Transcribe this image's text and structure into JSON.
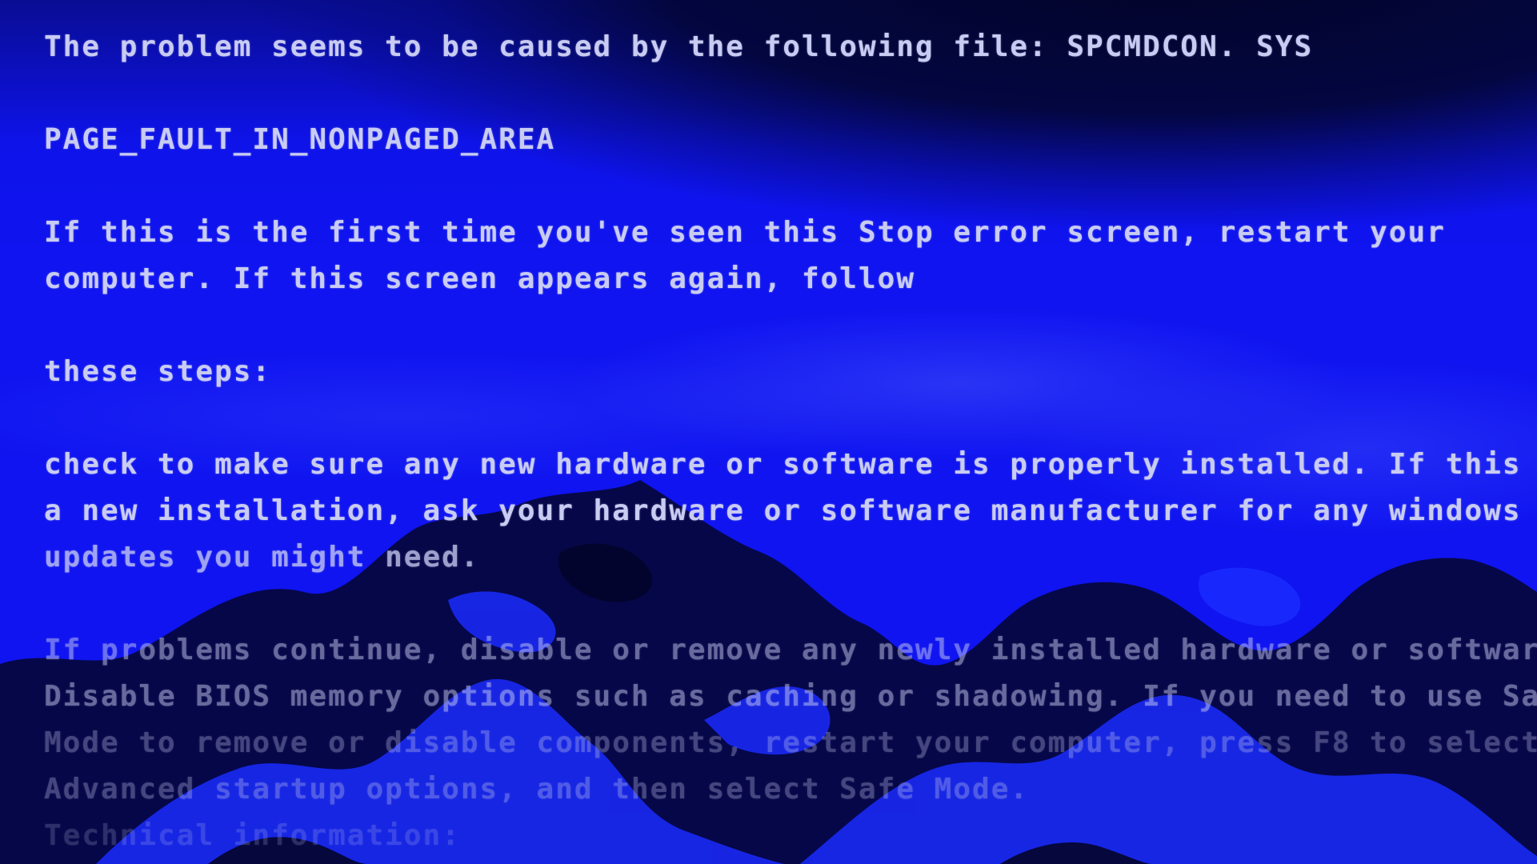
{
  "screen": {
    "background_color": "#0f14f0",
    "text_color": "#c9ccf2",
    "lines": {
      "cause": "The problem seems to be caused by the following file: SPCMDCON. SYS",
      "stop_code": "PAGE_FAULT_IN_NONPAGED_AREA",
      "first_time_1": "If this is the first time you've seen this Stop error screen, restart your",
      "first_time_2": "computer. If this screen appears again, follow",
      "steps_intro": "these steps:",
      "check_1": "check to make sure any new hardware or software is properly installed. If this is",
      "check_2": "a new installation, ask your hardware or software manufacturer for any windows",
      "check_3": "updates you might need.",
      "problems_1": "If problems continue, disable or remove any newly installed hardware or software.",
      "problems_2": "Disable BIOS memory options such as caching or shadowing. If you need to use Safe",
      "problems_3": "Mode to remove or disable components, restart your computer, press F8 to select",
      "problems_4": "Advanced startup options, and then select Safe Mode.",
      "tech_info": "Technical information:"
    }
  }
}
